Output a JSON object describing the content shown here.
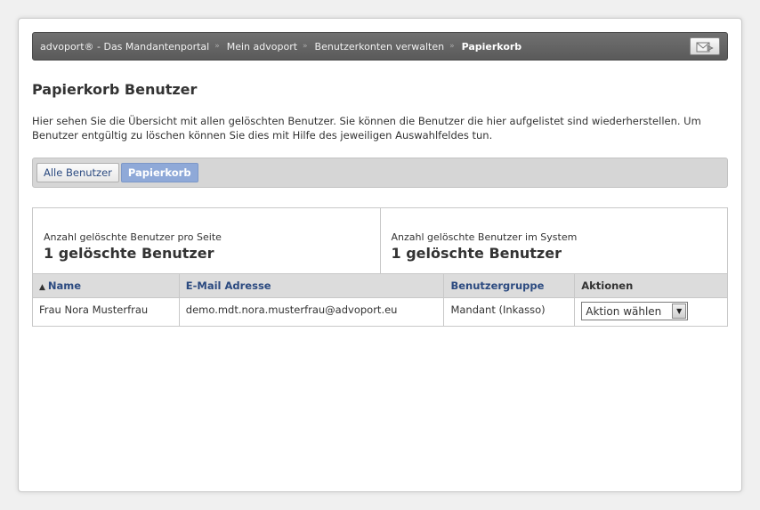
{
  "breadcrumb": {
    "items": [
      {
        "label": "advoport® - Das Mandantenportal"
      },
      {
        "label": "Mein advoport"
      },
      {
        "label": "Benutzerkonten verwalten"
      }
    ],
    "current": "Papierkorb",
    "separator": "»",
    "mail_icon": "mail-export-icon"
  },
  "page": {
    "title": "Papierkorb Benutzer",
    "intro": "Hier sehen Sie die Übersicht mit allen gelöschten Benutzer. Sie können die Benutzer die hier aufgelistet sind wiederherstellen. Um Benutzer entgültig zu löschen können Sie dies mit Hilfe des jeweiligen Auswahlfeldes tun."
  },
  "tabs": [
    {
      "label": "Alle Benutzer",
      "active": false
    },
    {
      "label": "Papierkorb",
      "active": true
    }
  ],
  "stats": {
    "per_page_label": "Anzahl gelöschte Benutzer pro Seite",
    "per_page_value": "1 gelöschte Benutzer",
    "in_system_label": "Anzahl gelöschte Benutzer im System",
    "in_system_value": "1 gelöschte Benutzer"
  },
  "table": {
    "sort_indicator": "▲",
    "columns": {
      "name": "Name",
      "email": "E-Mail Adresse",
      "group": "Benutzergruppe",
      "actions": "Aktionen"
    },
    "rows": [
      {
        "name": "Frau Nora Musterfrau",
        "email": "demo.mdt.nora.musterfrau@advoport.eu",
        "group": "Mandant (Inkasso)",
        "action_selected": "Aktion wählen"
      }
    ]
  },
  "colors": {
    "breadcrumb_bg": "#666666",
    "link": "#2b4a80",
    "active_tab": "#8fa9d8",
    "table_header_bg": "#dcdcdc"
  }
}
